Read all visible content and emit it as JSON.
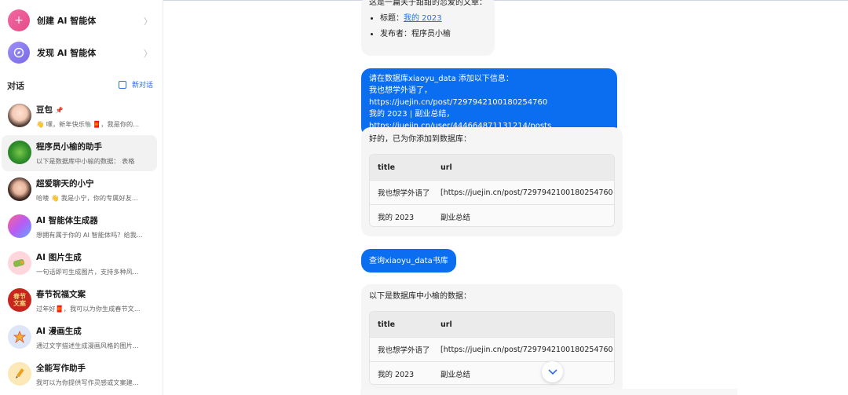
{
  "sidebar": {
    "menu": [
      {
        "label": "创建 AI 智能体",
        "icon": "plus-icon",
        "color": "#e85a9a"
      },
      {
        "label": "发现 AI 智能体",
        "icon": "compass-icon",
        "color": "#8b7ff0"
      }
    ],
    "section_title": "对话",
    "new_chat_label": "新对话",
    "conversations": [
      {
        "title": "豆包",
        "subtitle": "👋 嘿，新年快乐🐘🧧，我是你的...",
        "pin": "📌"
      },
      {
        "title": "程序员小榆的助手",
        "subtitle": "以下是数据库中小榆的数据： 表格"
      },
      {
        "title": "超爱聊天的小宁",
        "subtitle": "哈喽 👋 我是小宁，你的专属好友..."
      },
      {
        "title": "AI 智能体生成器",
        "subtitle": "想拥有属于你的 AI 智能体吗？给我..."
      },
      {
        "title": "AI 图片生成",
        "subtitle": "一句话即可生成图片，支持多种风..."
      },
      {
        "title": "春节祝福文案",
        "subtitle": "过年好🧧，我可以为你生成春节文...",
        "avatar_text": "春节文案"
      },
      {
        "title": "AI 漫画生成",
        "subtitle": "通过文字描述生成漫画风格的图片..."
      },
      {
        "title": "全能写作助手",
        "subtitle": "我可以为你提供写作灵感或文案建..."
      }
    ]
  },
  "chat": {
    "msg1": {
      "intro": "这是一篇关于甜甜的恋爱的文章：",
      "title_label": "标题：",
      "title_link": "我的 2023",
      "publisher": "发布者：程序员小榆"
    },
    "msg2": {
      "line1": "请在数据库xiaoyu_data 添加以下信息：",
      "line2": "我也想学外语了，https://juejin.cn/post/7297942100180254760",
      "line3": "我的 2023 | 副业总结，https://juejin.cn/user/444664871131214/posts"
    },
    "msg3": {
      "intro": "好的，已为你添加到数据库：",
      "headers": [
        "title",
        "url"
      ],
      "rows": [
        [
          "我也想学外语了",
          "[https://juejin.cn/post/7297942100180254760"
        ],
        [
          "我的 2023",
          "副业总结"
        ]
      ]
    },
    "msg4": {
      "text": "查询xiaoyu_data书库"
    },
    "msg5": {
      "intro": "以下是数据库中小榆的数据：",
      "headers": [
        "title",
        "url"
      ],
      "rows": [
        [
          "我也想学外语了",
          "[https://juejin.cn/post/7297942100180254760"
        ],
        [
          "我的 2023",
          "副业总结"
        ]
      ]
    },
    "scroll_down_icon": "chevron-down-icon"
  }
}
